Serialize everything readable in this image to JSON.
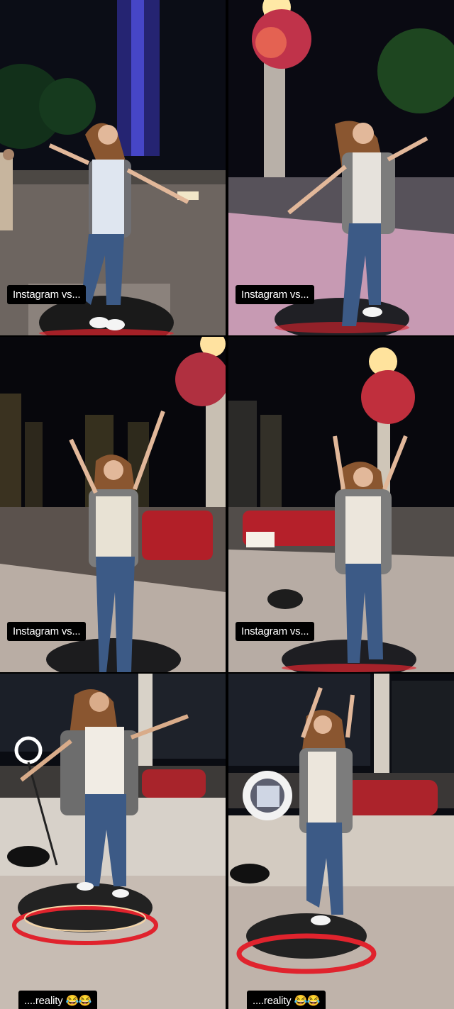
{
  "panels": [
    {
      "caption": "Instagram vs..."
    },
    {
      "caption": "Instagram vs..."
    },
    {
      "caption": "Instagram vs..."
    },
    {
      "caption": "Instagram vs..."
    },
    {
      "caption": "....reality 😂😂"
    },
    {
      "caption": "....reality 😂😂"
    }
  ],
  "colors": {
    "night_sky": "#0a0a14",
    "pavement": "#d9cfc9",
    "platform_ring": "#e0232d",
    "jacket": "#7c7c7c",
    "jeans": "#3c5a86",
    "hair": "#8a5630"
  }
}
